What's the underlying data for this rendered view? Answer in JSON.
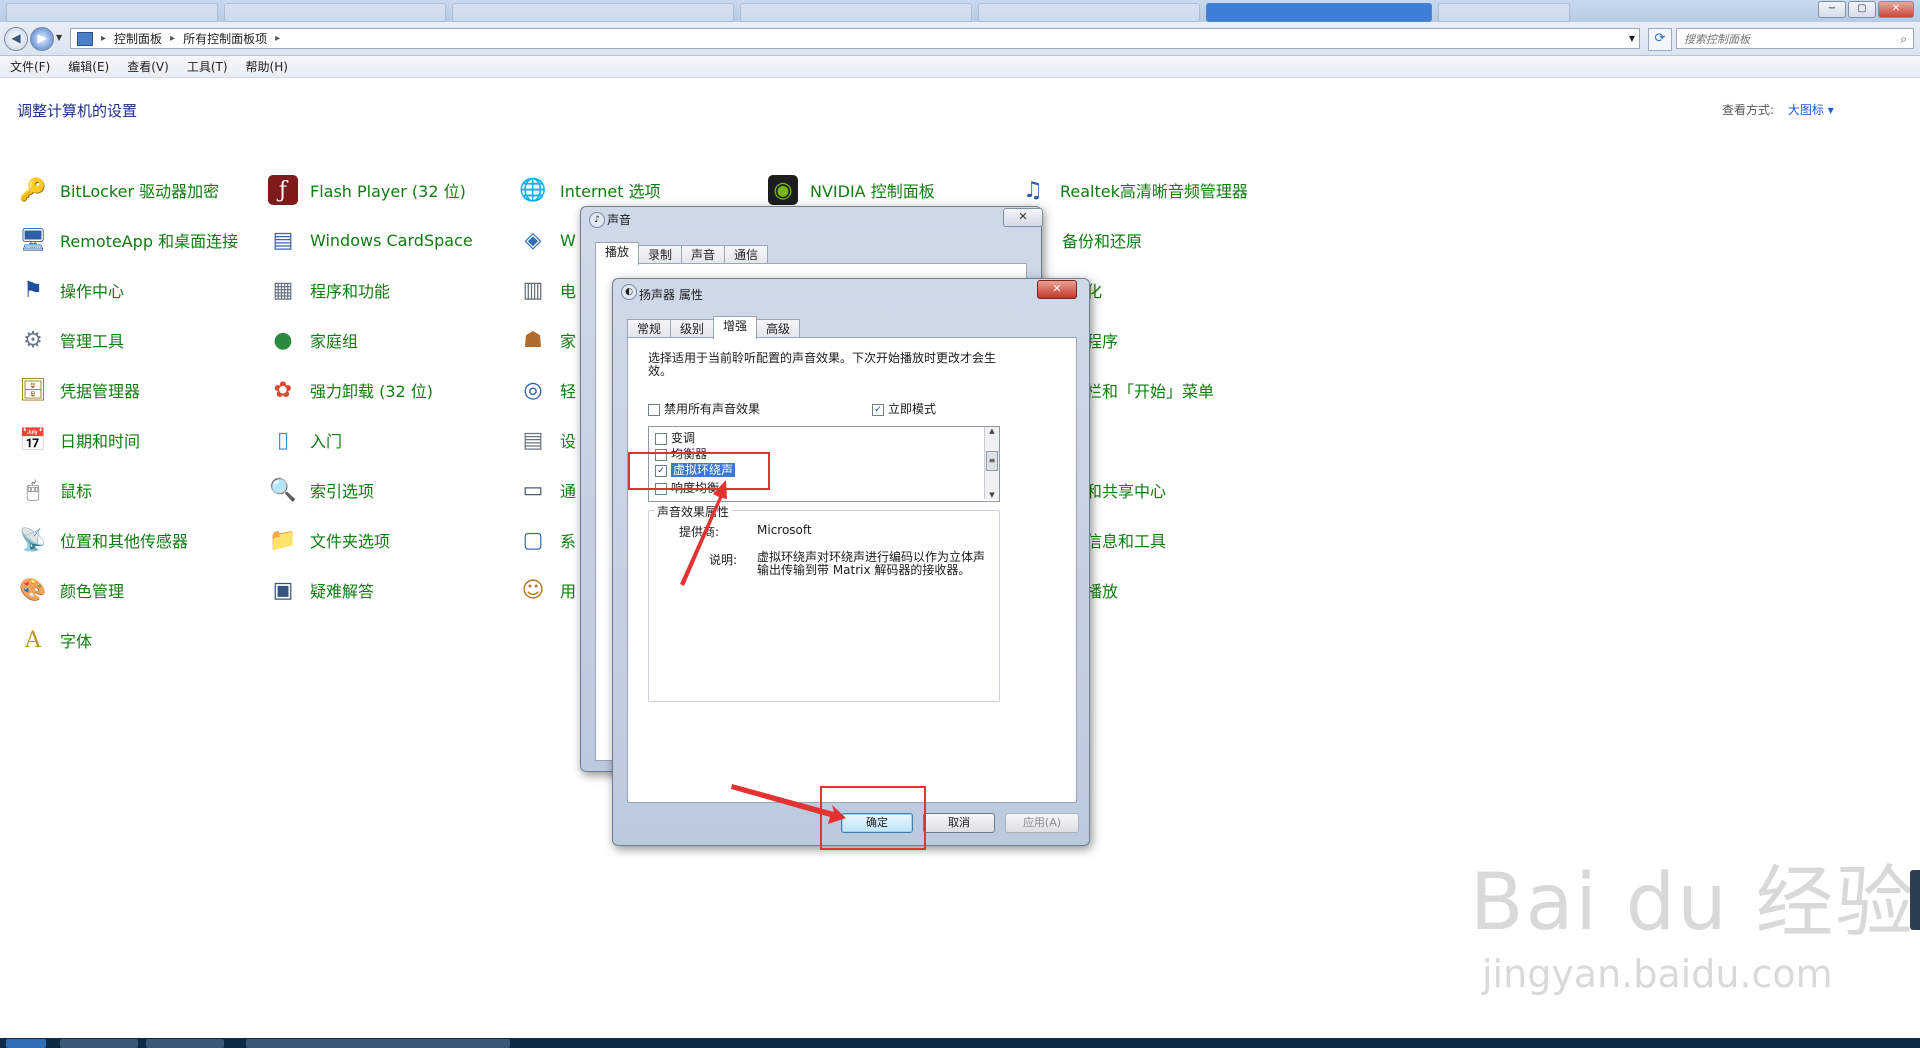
{
  "window": {
    "controls": {
      "minimize": "−",
      "maximize": "▢",
      "close": "✕"
    }
  },
  "address": {
    "crumbs": [
      "控制面板",
      "所有控制面板项"
    ],
    "search_placeholder": "搜索控制面板"
  },
  "menubar": [
    "文件(F)",
    "编辑(E)",
    "查看(V)",
    "工具(T)",
    "帮助(H)"
  ],
  "content": {
    "heading": "调整计算机的设置",
    "view_by_label": "查看方式:",
    "view_by_value": "大图标 ▾"
  },
  "items": [
    {
      "label": "BitLocker 驱动器加密",
      "icon": "🔑"
    },
    {
      "label": "RemoteApp 和桌面连接",
      "icon": "🖥"
    },
    {
      "label": "操作中心",
      "icon": "⚑"
    },
    {
      "label": "管理工具",
      "icon": "⚙"
    },
    {
      "label": "凭据管理器",
      "icon": "🗄"
    },
    {
      "label": "日期和时间",
      "icon": "📅"
    },
    {
      "label": "鼠标",
      "icon": "🖱"
    },
    {
      "label": "位置和其他传感器",
      "icon": "📡"
    },
    {
      "label": "颜色管理",
      "icon": "🎨"
    },
    {
      "label": "字体",
      "icon": "A"
    },
    {
      "label": "Flash Player (32 位)",
      "icon": "ƒ"
    },
    {
      "label": "Windows CardSpace",
      "icon": "▤"
    },
    {
      "label": "程序和功能",
      "icon": "▦"
    },
    {
      "label": "家庭组",
      "icon": "●"
    },
    {
      "label": "强力卸载 (32 位)",
      "icon": "✿"
    },
    {
      "label": "入门",
      "icon": "▯"
    },
    {
      "label": "索引选项",
      "icon": "🔍"
    },
    {
      "label": "文件夹选项",
      "icon": "📁"
    },
    {
      "label": "疑难解答",
      "icon": "▣"
    },
    {
      "label": "Internet 选项",
      "icon": "🌐"
    },
    {
      "label": "W",
      "icon": "◈"
    },
    {
      "label": "电",
      "icon": "▥"
    },
    {
      "label": "家",
      "icon": "☗"
    },
    {
      "label": "轻",
      "icon": "◎"
    },
    {
      "label": "设",
      "icon": "▤"
    },
    {
      "label": "通",
      "icon": "▭"
    },
    {
      "label": "系",
      "icon": "▢"
    },
    {
      "label": "用",
      "icon": "☺"
    },
    {
      "label": "NVIDIA 控制面板",
      "icon": "◉"
    },
    {
      "label": "Realtek高清晰音频管理器",
      "icon": "♫"
    },
    {
      "label": "备份和还原",
      "icon": ""
    },
    {
      "label": "化",
      "icon": ""
    },
    {
      "label": "程序",
      "icon": ""
    },
    {
      "label": "栏和「开始」菜单",
      "icon": ""
    },
    {
      "label": "和共享中心",
      "icon": ""
    },
    {
      "label": "信息和工具",
      "icon": ""
    },
    {
      "label": "播放",
      "icon": ""
    }
  ],
  "sound_dialog": {
    "title": "声音",
    "tabs": [
      "播放",
      "录制",
      "声音",
      "通信"
    ]
  },
  "speaker_dialog": {
    "title": "扬声器 属性",
    "tabs": [
      "常规",
      "级别",
      "增强",
      "高级"
    ],
    "description": "选择适用于当前聆听配置的声音效果。下次开始播放时更改才会生效。",
    "disable_all": "禁用所有声音效果",
    "immediate_mode": "立即模式",
    "effects": [
      {
        "label": "变调",
        "checked": false
      },
      {
        "label": "均衡器",
        "checked": false
      },
      {
        "label": "虚拟环绕声",
        "checked": true
      },
      {
        "label": "响度均衡",
        "checked": false
      }
    ],
    "props_group": "声音效果属性",
    "provider_label": "提供商:",
    "provider_value": "Microsoft",
    "desc_label": "说明:",
    "desc_value": "虚拟环绕声对环绕声进行编码以作为立体声输出传输到带 Matrix 解码器的接收器。",
    "ok": "确定",
    "cancel": "取消",
    "apply": "应用(A)"
  },
  "watermark": {
    "logo": "Bai du 经验",
    "url": "jingyan.baidu.com"
  },
  "annotation_color": "#e43131"
}
